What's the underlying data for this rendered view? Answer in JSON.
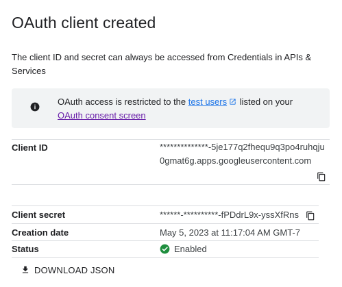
{
  "dialog": {
    "title": "OAuth client created",
    "description": "The client ID and secret can always be accessed from Credentials in APIs & Services"
  },
  "banner": {
    "text_before": "OAuth access is restricted to the ",
    "test_users_link": "test users",
    "text_after": " listed on your ",
    "consent_link": "OAuth consent screen",
    "info_icon": "info-icon",
    "external_link_icon": "open-in-new-icon"
  },
  "fields": {
    "client_id": {
      "label": "Client ID",
      "value": "**************-5je177q2fhequ9q3po4ruhqju0gmat6g.apps.googleusercontent.com",
      "copy_icon": "copy-icon"
    },
    "client_secret": {
      "label": "Client secret",
      "value": "******-**********-fPDdrL9x-yssXfRns",
      "copy_icon": "copy-icon"
    },
    "creation_date": {
      "label": "Creation date",
      "value": "May 5, 2023 at 11:17:04 AM GMT-7"
    },
    "status": {
      "label": "Status",
      "value": "Enabled",
      "icon": "check-circle-icon",
      "color": "#1e8e3e"
    }
  },
  "actions": {
    "download_label": "DOWNLOAD JSON",
    "download_icon": "download-icon"
  },
  "colors": {
    "link": "#1a73e8",
    "visited_link": "#681da8",
    "banner_bg": "#f1f3f4",
    "divider": "#dadce0"
  }
}
